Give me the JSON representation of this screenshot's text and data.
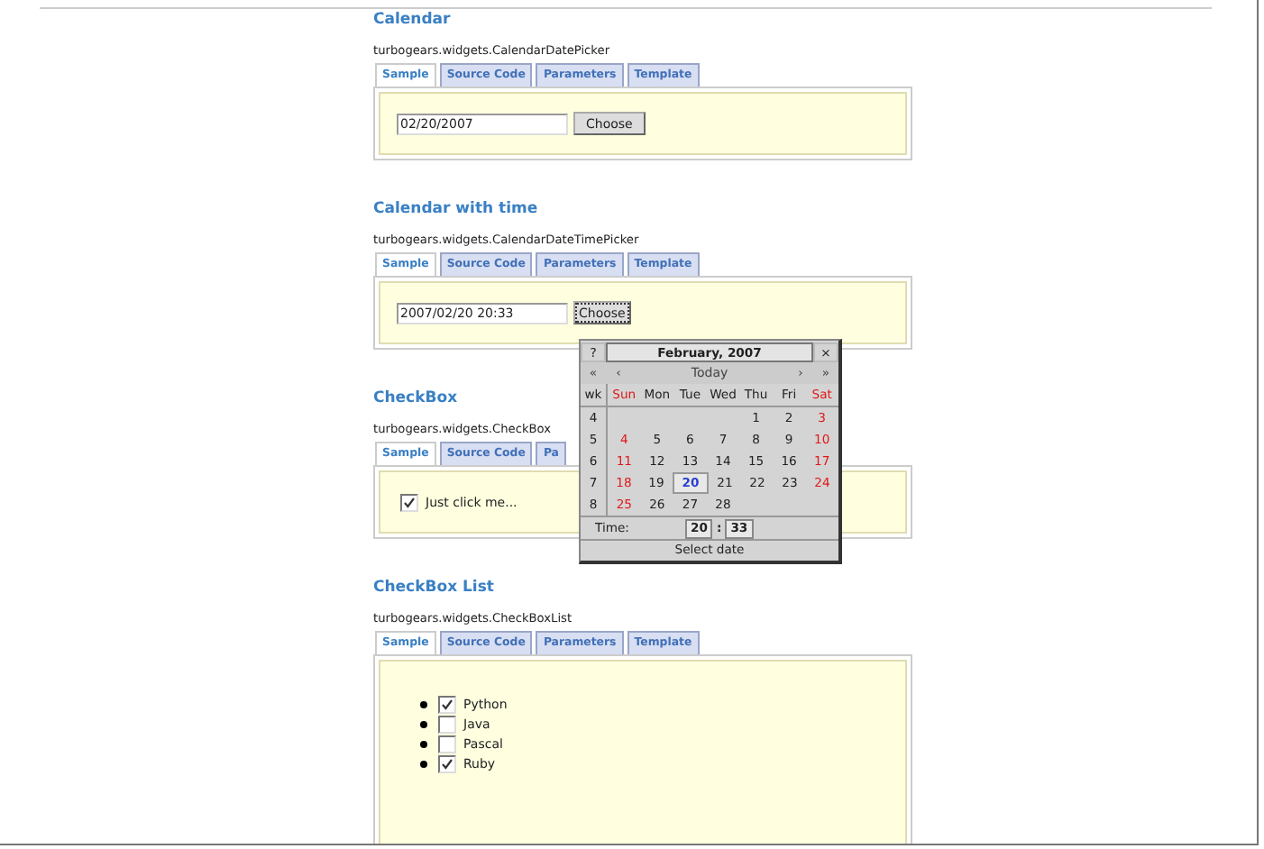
{
  "sections": [
    {
      "title": "Calendar",
      "subtitle": "turbogears.widgets.CalendarDatePicker",
      "tabs": [
        {
          "label": "Sample",
          "selected": true
        },
        {
          "label": "Source Code",
          "selected": false
        },
        {
          "label": "Parameters",
          "selected": false
        },
        {
          "label": "Template",
          "selected": false
        }
      ],
      "sample": {
        "kind": "date",
        "value": "02/20/2007",
        "button": "Choose",
        "focused": false
      }
    },
    {
      "title": "Calendar with time",
      "subtitle": "turbogears.widgets.CalendarDateTimePicker",
      "tabs": [
        {
          "label": "Sample",
          "selected": true
        },
        {
          "label": "Source Code",
          "selected": false
        },
        {
          "label": "Parameters",
          "selected": false
        },
        {
          "label": "Template",
          "selected": false
        }
      ],
      "sample": {
        "kind": "date",
        "value": "2007/02/20 20:33",
        "button": "Choose",
        "focused": true
      }
    },
    {
      "title": "CheckBox",
      "subtitle": "turbogears.widgets.CheckBox",
      "tabs": [
        {
          "label": "Sample",
          "selected": true
        },
        {
          "label": "Source Code",
          "selected": false
        },
        {
          "label": "Pa",
          "selected": false
        }
      ],
      "sample": {
        "kind": "checkbox",
        "label": "Just click me...",
        "checked": true
      }
    },
    {
      "title": "CheckBox List",
      "subtitle": "turbogears.widgets.CheckBoxList",
      "tabs": [
        {
          "label": "Sample",
          "selected": true
        },
        {
          "label": "Source Code",
          "selected": false
        },
        {
          "label": "Parameters",
          "selected": false
        },
        {
          "label": "Template",
          "selected": false
        }
      ],
      "sample": {
        "kind": "checklist",
        "items": [
          {
            "label": "Python",
            "checked": true
          },
          {
            "label": "Java",
            "checked": false
          },
          {
            "label": "Pascal",
            "checked": false
          },
          {
            "label": "Ruby",
            "checked": true
          }
        ]
      }
    }
  ],
  "calendar_popup": {
    "help": "?",
    "month": "February, 2007",
    "close": "×",
    "nav": [
      "«",
      "‹",
      "Today",
      "›",
      "»"
    ],
    "headers": [
      {
        "label": "wk",
        "weekend": false
      },
      {
        "label": "Sun",
        "weekend": true
      },
      {
        "label": "Mon",
        "weekend": false
      },
      {
        "label": "Tue",
        "weekend": false
      },
      {
        "label": "Wed",
        "weekend": false
      },
      {
        "label": "Thu",
        "weekend": false
      },
      {
        "label": "Fri",
        "weekend": false
      },
      {
        "label": "Sat",
        "weekend": true
      }
    ],
    "weeks": [
      {
        "wk": "4",
        "days": [
          {
            "text": "1",
            "weekend": false,
            "selected": false
          },
          {
            "text": "2",
            "weekend": false,
            "selected": false
          },
          {
            "text": "3",
            "weekend": true,
            "selected": false
          }
        ]
      },
      {
        "wk": "5",
        "days": [
          {
            "text": "4",
            "weekend": true,
            "selected": false
          },
          {
            "text": "5",
            "weekend": false,
            "selected": false
          },
          {
            "text": "6",
            "weekend": false,
            "selected": false
          },
          {
            "text": "7",
            "weekend": false,
            "selected": false
          },
          {
            "text": "8",
            "weekend": false,
            "selected": false
          },
          {
            "text": "9",
            "weekend": false,
            "selected": false
          },
          {
            "text": "10",
            "weekend": true,
            "selected": false
          }
        ]
      },
      {
        "wk": "6",
        "days": [
          {
            "text": "11",
            "weekend": true,
            "selected": false
          },
          {
            "text": "12",
            "weekend": false,
            "selected": false
          },
          {
            "text": "13",
            "weekend": false,
            "selected": false
          },
          {
            "text": "14",
            "weekend": false,
            "selected": false
          },
          {
            "text": "15",
            "weekend": false,
            "selected": false
          },
          {
            "text": "16",
            "weekend": false,
            "selected": false
          },
          {
            "text": "17",
            "weekend": true,
            "selected": false
          }
        ]
      },
      {
        "wk": "7",
        "days": [
          {
            "text": "18",
            "weekend": true,
            "selected": false
          },
          {
            "text": "19",
            "weekend": false,
            "selected": false
          },
          {
            "text": "20",
            "weekend": false,
            "selected": true
          },
          {
            "text": "21",
            "weekend": false,
            "selected": false
          },
          {
            "text": "22",
            "weekend": false,
            "selected": false
          },
          {
            "text": "23",
            "weekend": false,
            "selected": false
          },
          {
            "text": "24",
            "weekend": true,
            "selected": false
          }
        ]
      },
      {
        "wk": "8",
        "days": [
          {
            "text": "25",
            "weekend": true,
            "selected": false
          },
          {
            "text": "26",
            "weekend": false,
            "selected": false
          },
          {
            "text": "27",
            "weekend": false,
            "selected": false
          },
          {
            "text": "28",
            "weekend": false,
            "selected": false
          }
        ]
      }
    ],
    "time_label": "Time:",
    "hour": "20",
    "separator": ":",
    "minute": "33",
    "status": "Select date"
  }
}
